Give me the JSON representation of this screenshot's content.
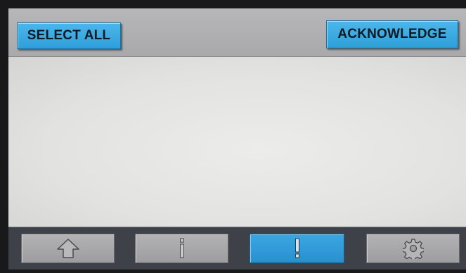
{
  "toolbar": {
    "select_all_label": "SELECT ALL",
    "acknowledge_label": "ACKNOWLEDGE"
  },
  "nav": {
    "items": [
      {
        "icon": "home-icon",
        "active": false
      },
      {
        "icon": "info-icon",
        "active": false
      },
      {
        "icon": "alarm-icon",
        "active": true
      },
      {
        "icon": "gear-icon",
        "active": false
      }
    ]
  },
  "colors": {
    "accent_blue": "#3aa7e2",
    "nav_gray": "#a9a9ab",
    "bottom_bar": "#3e4147",
    "content_bg": "#e6e6e5"
  }
}
